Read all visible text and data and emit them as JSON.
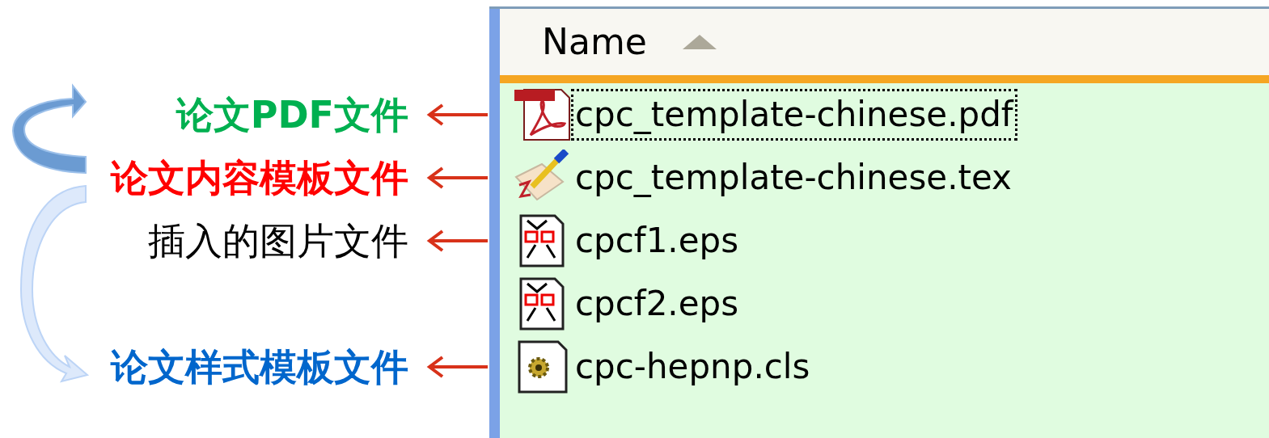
{
  "header": {
    "column": "Name",
    "sort_ascending": true
  },
  "files": [
    {
      "name": "cpc_template-chinese.pdf",
      "kind": "pdf",
      "focused": true,
      "annotation": {
        "text": "论文PDF文件",
        "color": "#00b050",
        "bold": true
      }
    },
    {
      "name": "cpc_template-chinese.tex",
      "kind": "tex",
      "focused": false,
      "annotation": {
        "text": "论文内容模板文件",
        "color": "#ff0000",
        "bold": true
      }
    },
    {
      "name": "cpcf1.eps",
      "kind": "eps",
      "focused": false,
      "annotation": {
        "text": "插入的图片文件",
        "color": "#000000",
        "bold": false
      }
    },
    {
      "name": "cpcf2.eps",
      "kind": "eps",
      "focused": false
    },
    {
      "name": "cpc-hepnp.cls",
      "kind": "cls",
      "focused": false,
      "annotation": {
        "text": "论文样式模板文件",
        "color": "#0066cc",
        "bold": true
      }
    }
  ]
}
